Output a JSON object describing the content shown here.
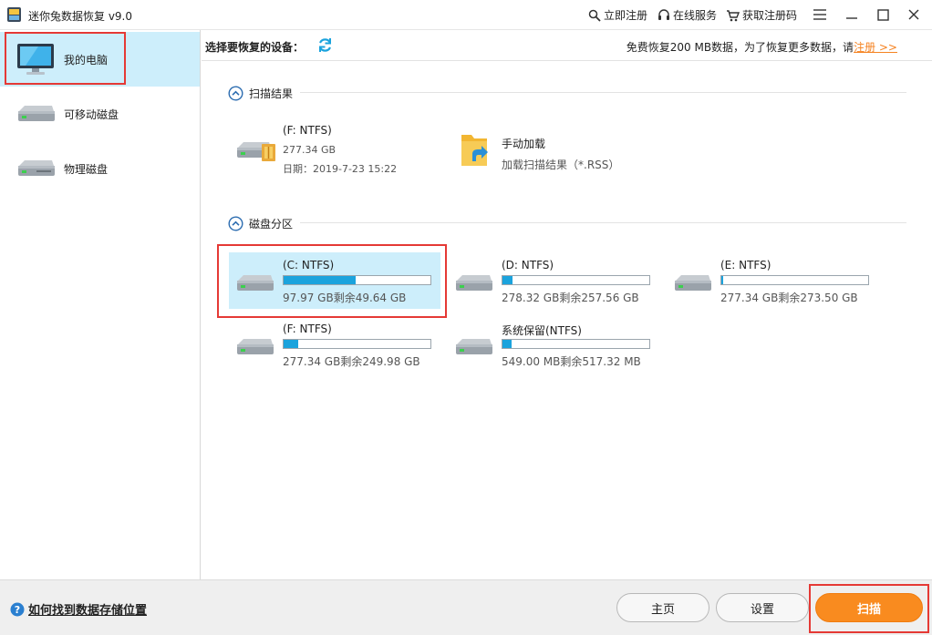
{
  "app": {
    "title": "迷你兔数据恢复 v9.0",
    "top_links": [
      "立即注册",
      "在线服务",
      "获取注册码"
    ],
    "window_buttons": [
      "menu-icon",
      "minimize-icon",
      "maximize-icon",
      "close-icon"
    ]
  },
  "sidebar": {
    "items": [
      {
        "label": "我的电脑",
        "icon": "monitor-icon",
        "active": true
      },
      {
        "label": "可移动磁盘",
        "icon": "removable-disk-icon",
        "active": false
      },
      {
        "label": "物理磁盘",
        "icon": "physical-disk-icon",
        "active": false
      }
    ]
  },
  "header": {
    "select_label": "选择要恢复的设备：",
    "promo_text": "免费恢复200 MB数据，为了恢复更多数据，请",
    "promo_link": "注册 >>"
  },
  "scan_results": {
    "title": "扫描结果",
    "items": [
      {
        "name": "(F: NTFS)",
        "size": "277.34 GB",
        "date": "日期：2019-7-23 15:22",
        "icon": "drive-lock-icon"
      },
      {
        "name": "手动加载",
        "desc": "加载扫描结果（*.RSS）",
        "icon": "folder-arrow-icon"
      }
    ]
  },
  "partitions": {
    "title": "磁盘分区",
    "items": [
      {
        "name": "(C: NTFS)",
        "info": "97.97 GB剩余49.64 GB",
        "used_fraction": 0.49,
        "selected": true
      },
      {
        "name": "(D: NTFS)",
        "info": "278.32 GB剩余257.56 GB",
        "used_fraction": 0.07,
        "selected": false
      },
      {
        "name": "(E: NTFS)",
        "info": "277.34 GB剩余273.50 GB",
        "used_fraction": 0.01,
        "selected": false
      },
      {
        "name": "(F: NTFS)",
        "info": "277.34 GB剩余249.98 GB",
        "used_fraction": 0.1,
        "selected": false
      },
      {
        "name": "系统保留(NTFS)",
        "info": "549.00 MB剩余517.32 MB",
        "used_fraction": 0.06,
        "selected": false
      }
    ]
  },
  "footer": {
    "help_text": "如何找到数据存储位置",
    "home_label": "主页",
    "settings_label": "设置",
    "scan_label": "扫描"
  },
  "colors": {
    "accent": "#1ba3dd",
    "selection": "#cdeefb",
    "scan_button": "#f98b1f",
    "highlight": "#e53935",
    "promo_link": "#f58220"
  }
}
